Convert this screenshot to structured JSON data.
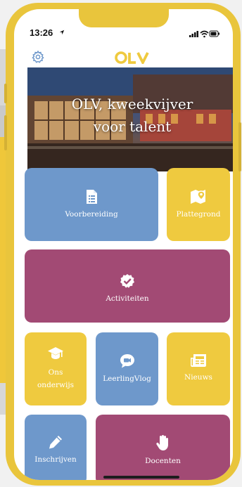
{
  "status_bar": {
    "time": "13:26"
  },
  "header": {
    "logo_text": "OLV",
    "settings_icon": "gear-icon"
  },
  "hero": {
    "line1": "OLV, kweekvijver",
    "line2": "voor talent"
  },
  "tiles": {
    "voorbereiding": {
      "label": "Voorbereiding",
      "icon": "document-list-icon"
    },
    "plattegrond": {
      "label": "Plattegrond",
      "icon": "map-pin-icon"
    },
    "activiteiten": {
      "label": "Activiteiten",
      "icon": "badge-check-icon"
    },
    "onderwijs": {
      "label_line1": "Ons",
      "label_line2": "onderwijs",
      "icon": "graduation-cap-icon"
    },
    "leerlingvlog": {
      "label": "LeerlingVlog",
      "icon": "video-chat-icon"
    },
    "nieuws": {
      "label": "Nieuws",
      "icon": "newspaper-icon"
    },
    "inschrijven": {
      "label": "Inschrijven",
      "icon": "pencil-icon"
    },
    "docenten": {
      "label": "Docenten",
      "icon": "raised-hand-icon"
    }
  },
  "colors": {
    "frame": "#e9c53c",
    "tile_blue": "#6e98cb",
    "tile_yellow": "#efca3f",
    "tile_purple": "#a24a74"
  }
}
